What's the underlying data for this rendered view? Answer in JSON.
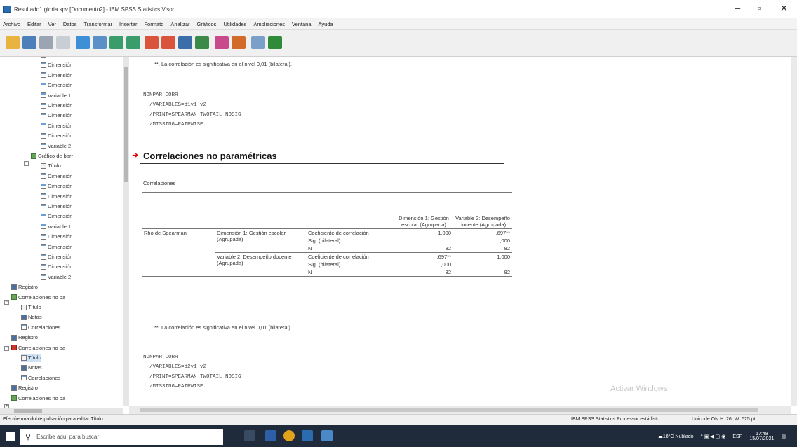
{
  "window": {
    "title": "Resultado1 gloria.spv [Documento2] - IBM SPSS Statistics Visor",
    "controls": {
      "minimize": "–",
      "maximize": "▫",
      "close": "✕"
    }
  },
  "menu": [
    "Archivo",
    "Editar",
    "Ver",
    "Datos",
    "Transformar",
    "Insertar",
    "Formato",
    "Analizar",
    "Gráficos",
    "Utilidades",
    "Ampliaciones",
    "Ventana",
    "Ayuda"
  ],
  "nav_tree": [
    {
      "label": "Dimensión",
      "icon": "table"
    },
    {
      "label": "Dimensión",
      "icon": "table"
    },
    {
      "label": "Dimensión",
      "icon": "table"
    },
    {
      "label": "Dimensión",
      "icon": "table"
    },
    {
      "label": "Variable 1",
      "icon": "table"
    },
    {
      "label": "Dimensión",
      "icon": "table"
    },
    {
      "label": "Dimensión",
      "icon": "table"
    },
    {
      "label": "Dimensión",
      "icon": "table"
    },
    {
      "label": "Dimensión",
      "icon": "table"
    },
    {
      "label": "Variable 2",
      "icon": "table"
    },
    {
      "label": "Gráfico de barr",
      "icon": "group"
    },
    {
      "label": "Título",
      "icon": "title"
    },
    {
      "label": "Dimensión",
      "icon": "table"
    },
    {
      "label": "Dimensión",
      "icon": "table"
    },
    {
      "label": "Dimensión",
      "icon": "table"
    },
    {
      "label": "Dimensión",
      "icon": "table"
    },
    {
      "label": "Dimensión",
      "icon": "table"
    },
    {
      "label": "Variable 1",
      "icon": "table"
    },
    {
      "label": "Dimensión",
      "icon": "table"
    },
    {
      "label": "Dimensión",
      "icon": "table"
    },
    {
      "label": "Dimensión",
      "icon": "table"
    },
    {
      "label": "Dimensión",
      "icon": "table"
    },
    {
      "label": "Variable 2",
      "icon": "table"
    },
    {
      "label": "Registro",
      "icon": "log"
    },
    {
      "label": "Correlaciones no pa",
      "icon": "group"
    },
    {
      "label": "Título",
      "icon": "title"
    },
    {
      "label": "Notas",
      "icon": "log"
    },
    {
      "label": "Correlaciones",
      "icon": "table"
    },
    {
      "label": "Registro",
      "icon": "log"
    },
    {
      "label": "Correlaciones no pa",
      "icon": "red"
    },
    {
      "label": "Título",
      "icon": "title"
    },
    {
      "label": "Notas",
      "icon": "log"
    },
    {
      "label": "Correlaciones",
      "icon": "table"
    },
    {
      "label": "Registro",
      "icon": "log"
    },
    {
      "label": "Correlaciones no pa",
      "icon": "group"
    }
  ],
  "content": {
    "note_top": "**. La correlación es significativa en el nivel 0,01 (bilateral).",
    "syntax1": "NONPAR CORR\n  /VARIABLES=d1v1 v2\n  /PRINT=SPEARMAN TWOTAIL NOSIG\n  /MISSING=PAIRWISE.",
    "heading": "Correlaciones no paramétricas",
    "table_title": "Correlaciones",
    "col_headers": [
      "Dimensión 1: Gestión escolar (Agrupada)",
      "Variable 2: Desempeño docente (Agrupada)"
    ],
    "row_group": "Rho de Spearman",
    "rows": [
      {
        "var": "Dimensión 1: Gestión escolar (Agrupada)",
        "stats": [
          {
            "label": "Coeficiente de correlación",
            "c1": "1,000",
            "c2": ",697**"
          },
          {
            "label": "Sig. (bilateral)",
            "c1": "",
            "c2": ",000"
          },
          {
            "label": "N",
            "c1": "82",
            "c2": "82"
          }
        ]
      },
      {
        "var": "Variable 2: Desempeño docente (Agrupada)",
        "stats": [
          {
            "label": "Coeficiente de correlación",
            "c1": ",697**",
            "c2": "1,000"
          },
          {
            "label": "Sig. (bilateral)",
            "c1": ",000",
            "c2": ""
          },
          {
            "label": "N",
            "c1": "82",
            "c2": "82"
          }
        ]
      }
    ],
    "note_bottom": "**. La correlación es significativa en el nivel 0,01 (bilateral).",
    "syntax2": "NONPAR CORR\n  /VARIABLES=d2v1 v2\n  /PRINT=SPEARMAN TWOTAIL NOSIG\n  /MISSING=PAIRWISE.",
    "watermark": "Activar Windows"
  },
  "status": {
    "left": "Efectúe una doble pulsación para editar Título",
    "processor": "IBM SPSS Statistics Processor está listo",
    "encoding": "Unicode:ON  H: 26, W: 525 pt"
  },
  "taskbar": {
    "search_placeholder": "Escribe aquí para buscar",
    "weather": "18°C Nublado",
    "lang": "ESP",
    "time": "17:48",
    "date": "15/07/2021"
  }
}
